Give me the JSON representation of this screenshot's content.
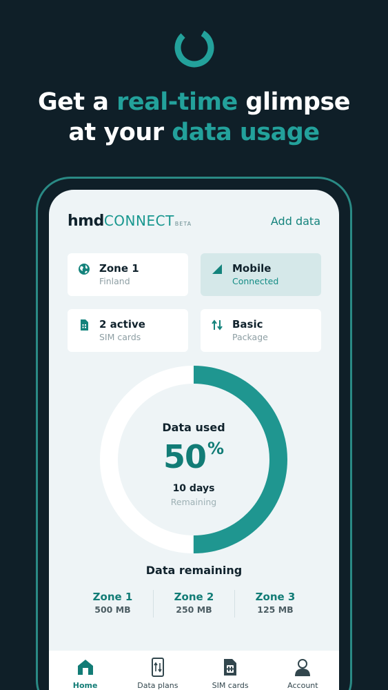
{
  "headline": {
    "line1_a": "Get a ",
    "line1_hl": "real-time",
    "line1_b": " glimpse",
    "line2_a": "at your ",
    "line2_hl": "data usage"
  },
  "app": {
    "brand_hmd": "hmd",
    "brand_connect": "CONNECT",
    "brand_beta": "BETA",
    "add_data": "Add data"
  },
  "cards": [
    {
      "title": "Zone 1",
      "sub": "Finland",
      "icon": "globe-icon"
    },
    {
      "title": "Mobile",
      "sub": "Connected",
      "icon": "signal-icon"
    },
    {
      "title": "2 active",
      "sub": "SIM cards",
      "icon": "sim-icon"
    },
    {
      "title": "Basic",
      "sub": "Package",
      "icon": "arrows-icon"
    }
  ],
  "gauge": {
    "label": "Data used",
    "value": "50",
    "unit": "%",
    "fraction": 0.5,
    "days": "10 days",
    "days_label": "Remaining"
  },
  "remaining": {
    "title": "Data remaining",
    "zones": [
      {
        "name": "Zone 1",
        "value": "500 MB"
      },
      {
        "name": "Zone 2",
        "value": "250 MB"
      },
      {
        "name": "Zone 3",
        "value": "125 MB"
      }
    ]
  },
  "nav": [
    {
      "label": "Home",
      "icon": "home-icon"
    },
    {
      "label": "Data plans",
      "icon": "data-plans-icon"
    },
    {
      "label": "SIM cards",
      "icon": "sim-card-icon"
    },
    {
      "label": "Account",
      "icon": "account-icon"
    }
  ],
  "colors": {
    "background": "#0f1f28",
    "accent": "#23a19b",
    "accent_dark": "#127c76",
    "screen": "#eef4f6"
  }
}
